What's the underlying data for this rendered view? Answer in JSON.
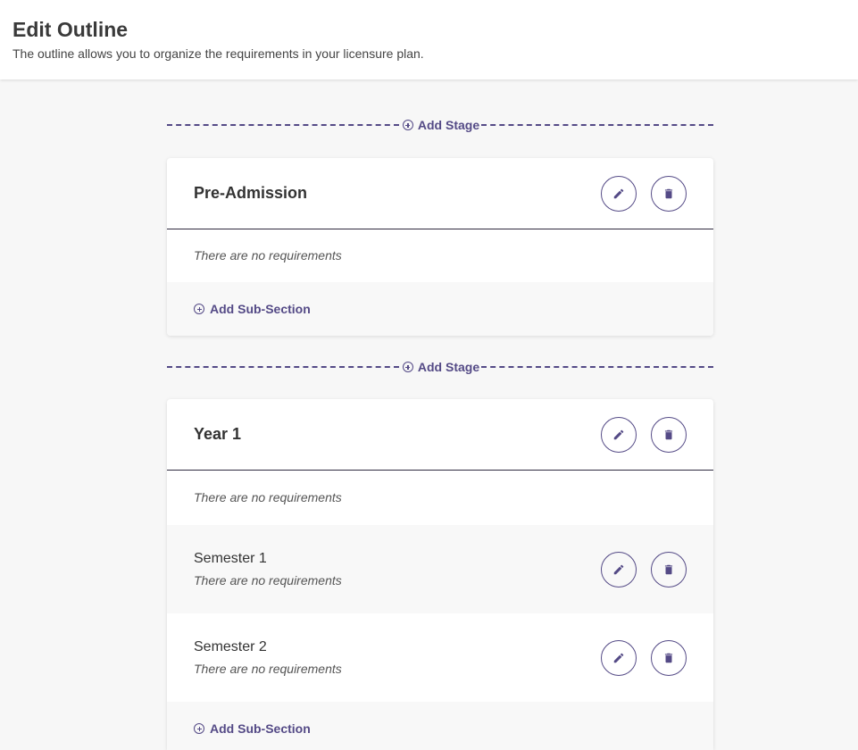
{
  "header": {
    "title": "Edit Outline",
    "subtitle": "The outline allows you to organize the requirements in your licensure plan."
  },
  "add_stage_label": "Add Stage",
  "add_sub_section_label": "Add Sub-Section",
  "empty_text": "There are no requirements",
  "stages": [
    {
      "title": "Pre-Admission",
      "sub_sections": []
    },
    {
      "title": "Year 1",
      "sub_sections": [
        {
          "title": "Semester 1"
        },
        {
          "title": "Semester 2"
        }
      ]
    }
  ],
  "colors": {
    "accent": "#544a86",
    "background": "#f7f7f7",
    "card": "#ffffff"
  },
  "icons": {
    "add": "plus-circle-icon",
    "edit": "pencil-icon",
    "delete": "trash-icon"
  }
}
